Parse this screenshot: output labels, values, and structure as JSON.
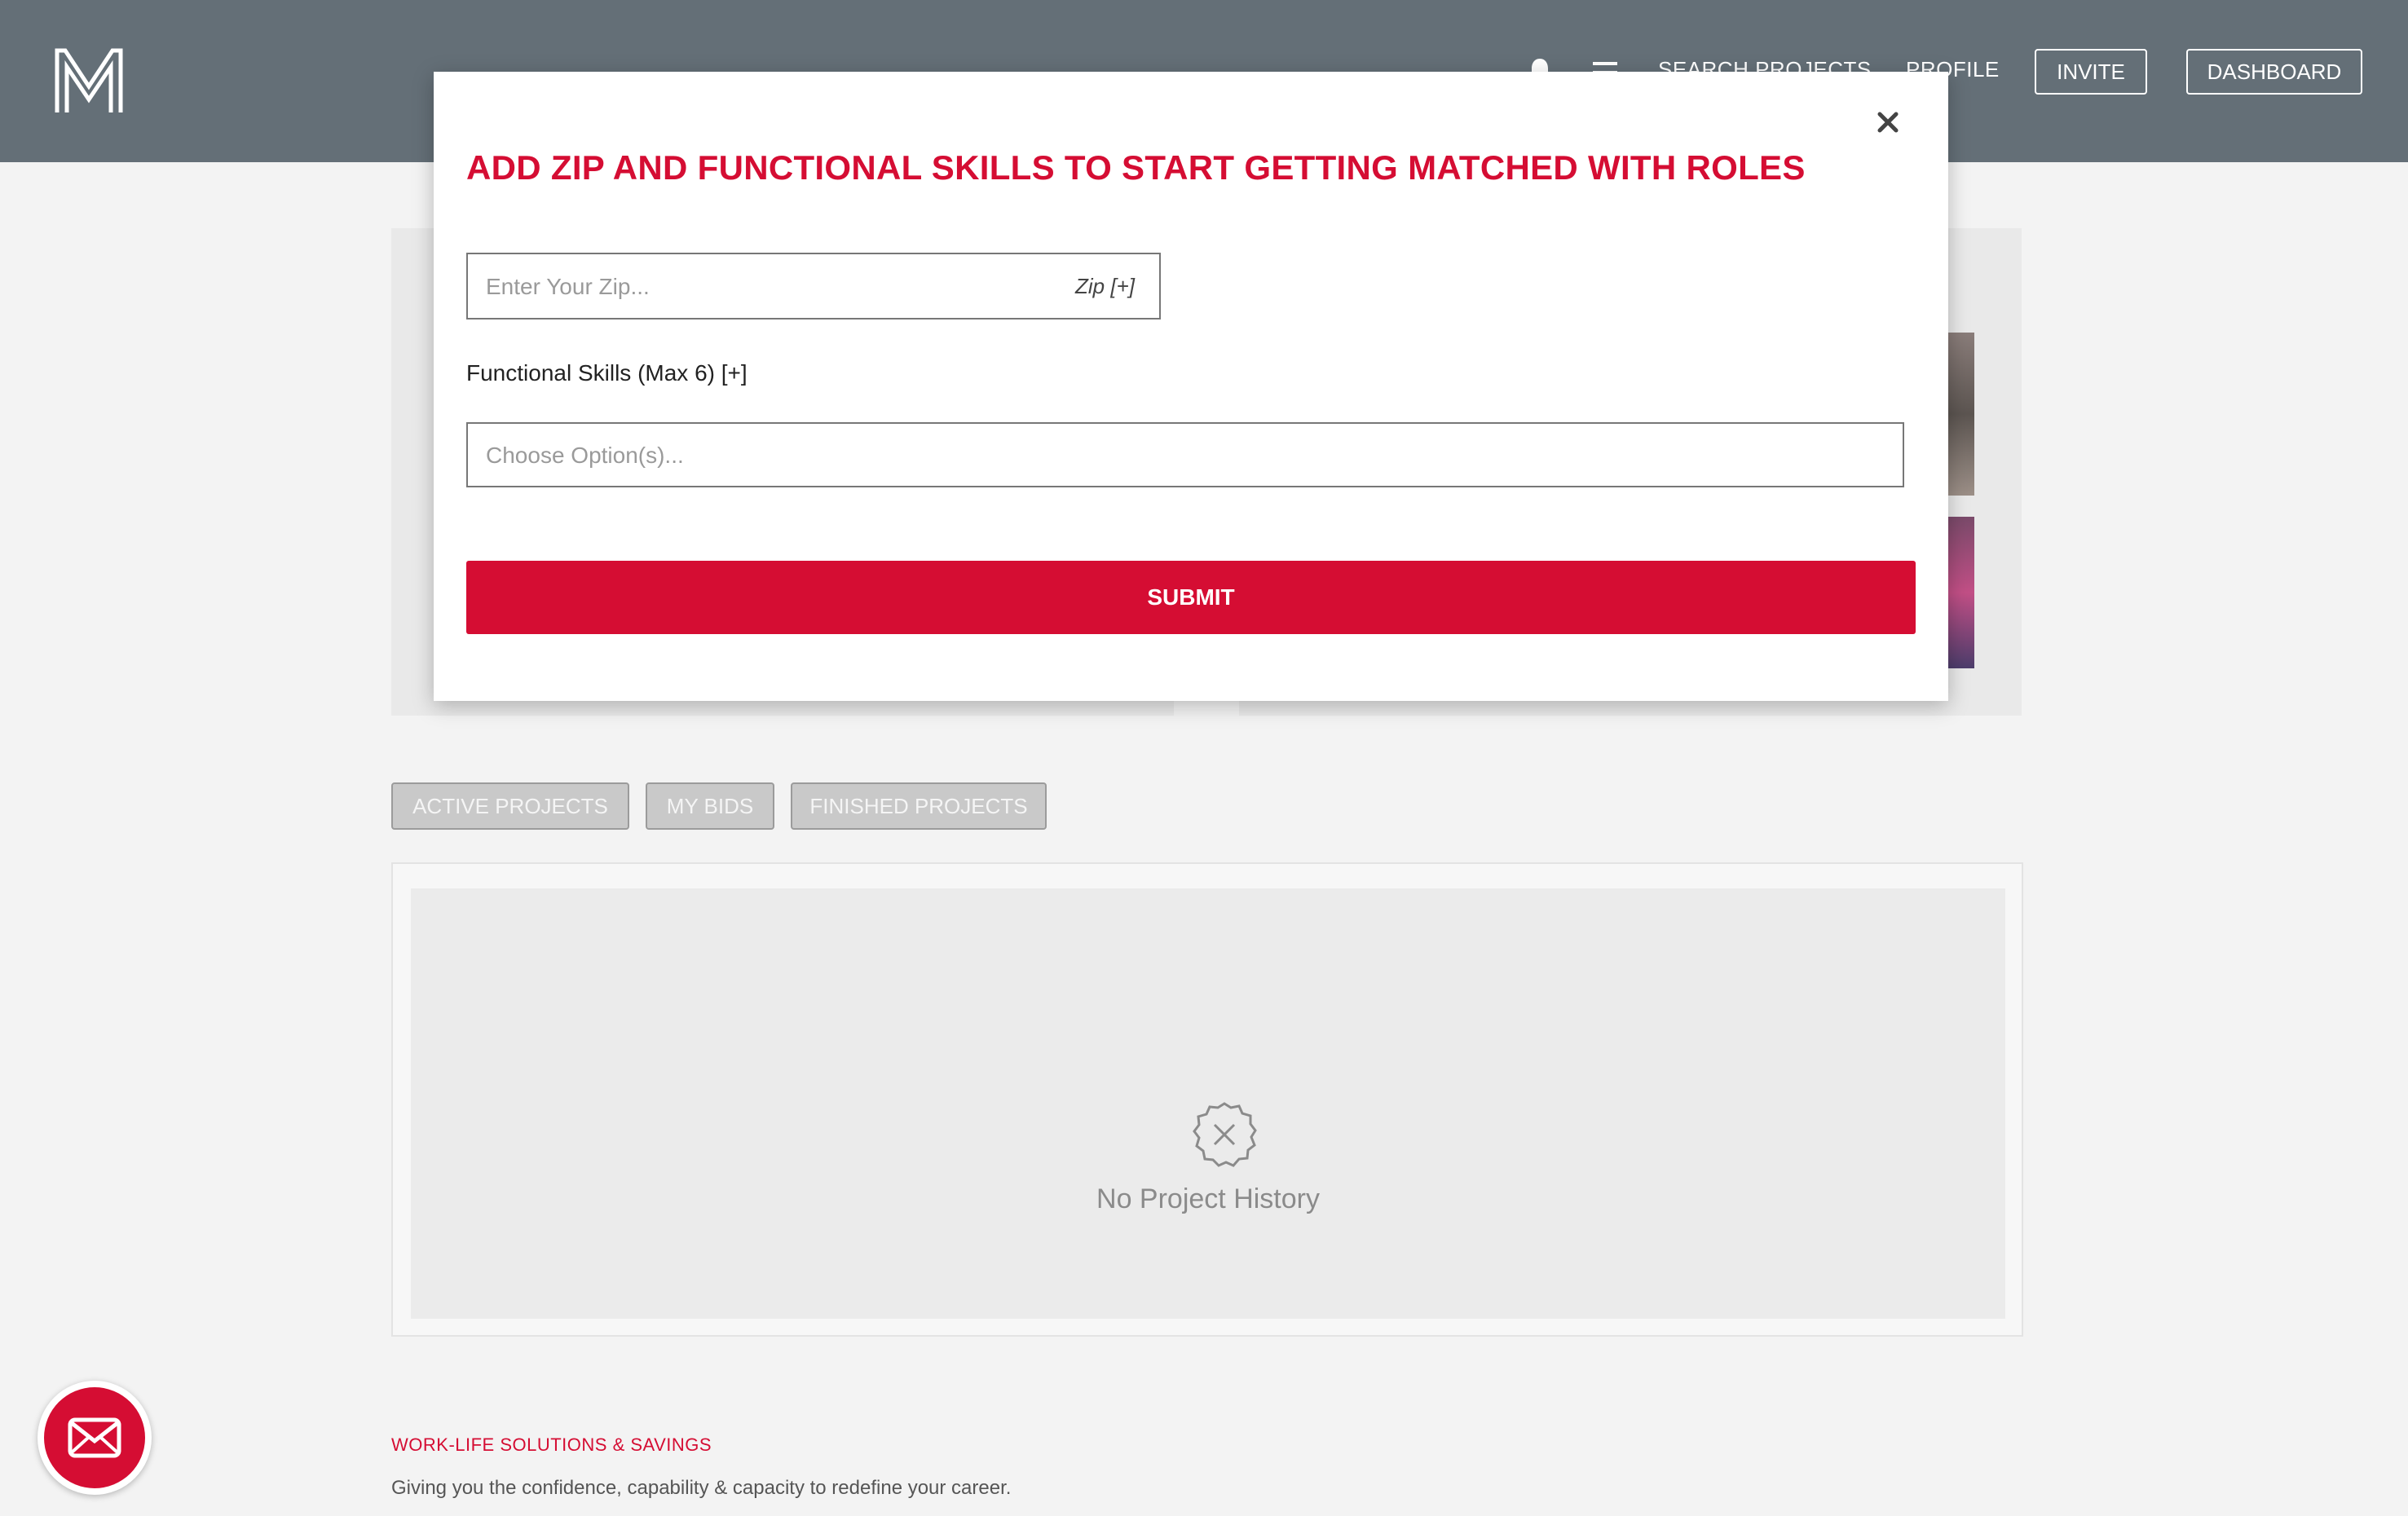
{
  "header": {
    "logo_letter": "M",
    "nav": {
      "search_projects": "SEARCH PROJECTS",
      "profile": "PROFILE",
      "invite": "INVITE",
      "dashboard": "DASHBOARD"
    },
    "background_color": "#646f77"
  },
  "modal": {
    "title": "ADD ZIP AND FUNCTIONAL SKILLS TO START GETTING MATCHED WITH ROLES",
    "zip": {
      "placeholder": "Enter Your Zip...",
      "value": "",
      "add_label": "Zip [+]"
    },
    "skills": {
      "label": "Functional Skills (Max 6) [+]",
      "placeholder": "Choose Option(s)...",
      "value": ""
    },
    "submit_label": "SUBMIT",
    "accent_color": "#d50d33"
  },
  "tabs": [
    {
      "label": "ACTIVE PROJECTS"
    },
    {
      "label": "MY BIDS"
    },
    {
      "label": "FINISHED PROJECTS"
    }
  ],
  "history": {
    "empty_text": "No Project History",
    "icon": "no-history-icon"
  },
  "footer": {
    "title": "WORK-LIFE SOLUTIONS & SAVINGS",
    "text": "Giving you the confidence, capability & capacity to redefine your career."
  }
}
